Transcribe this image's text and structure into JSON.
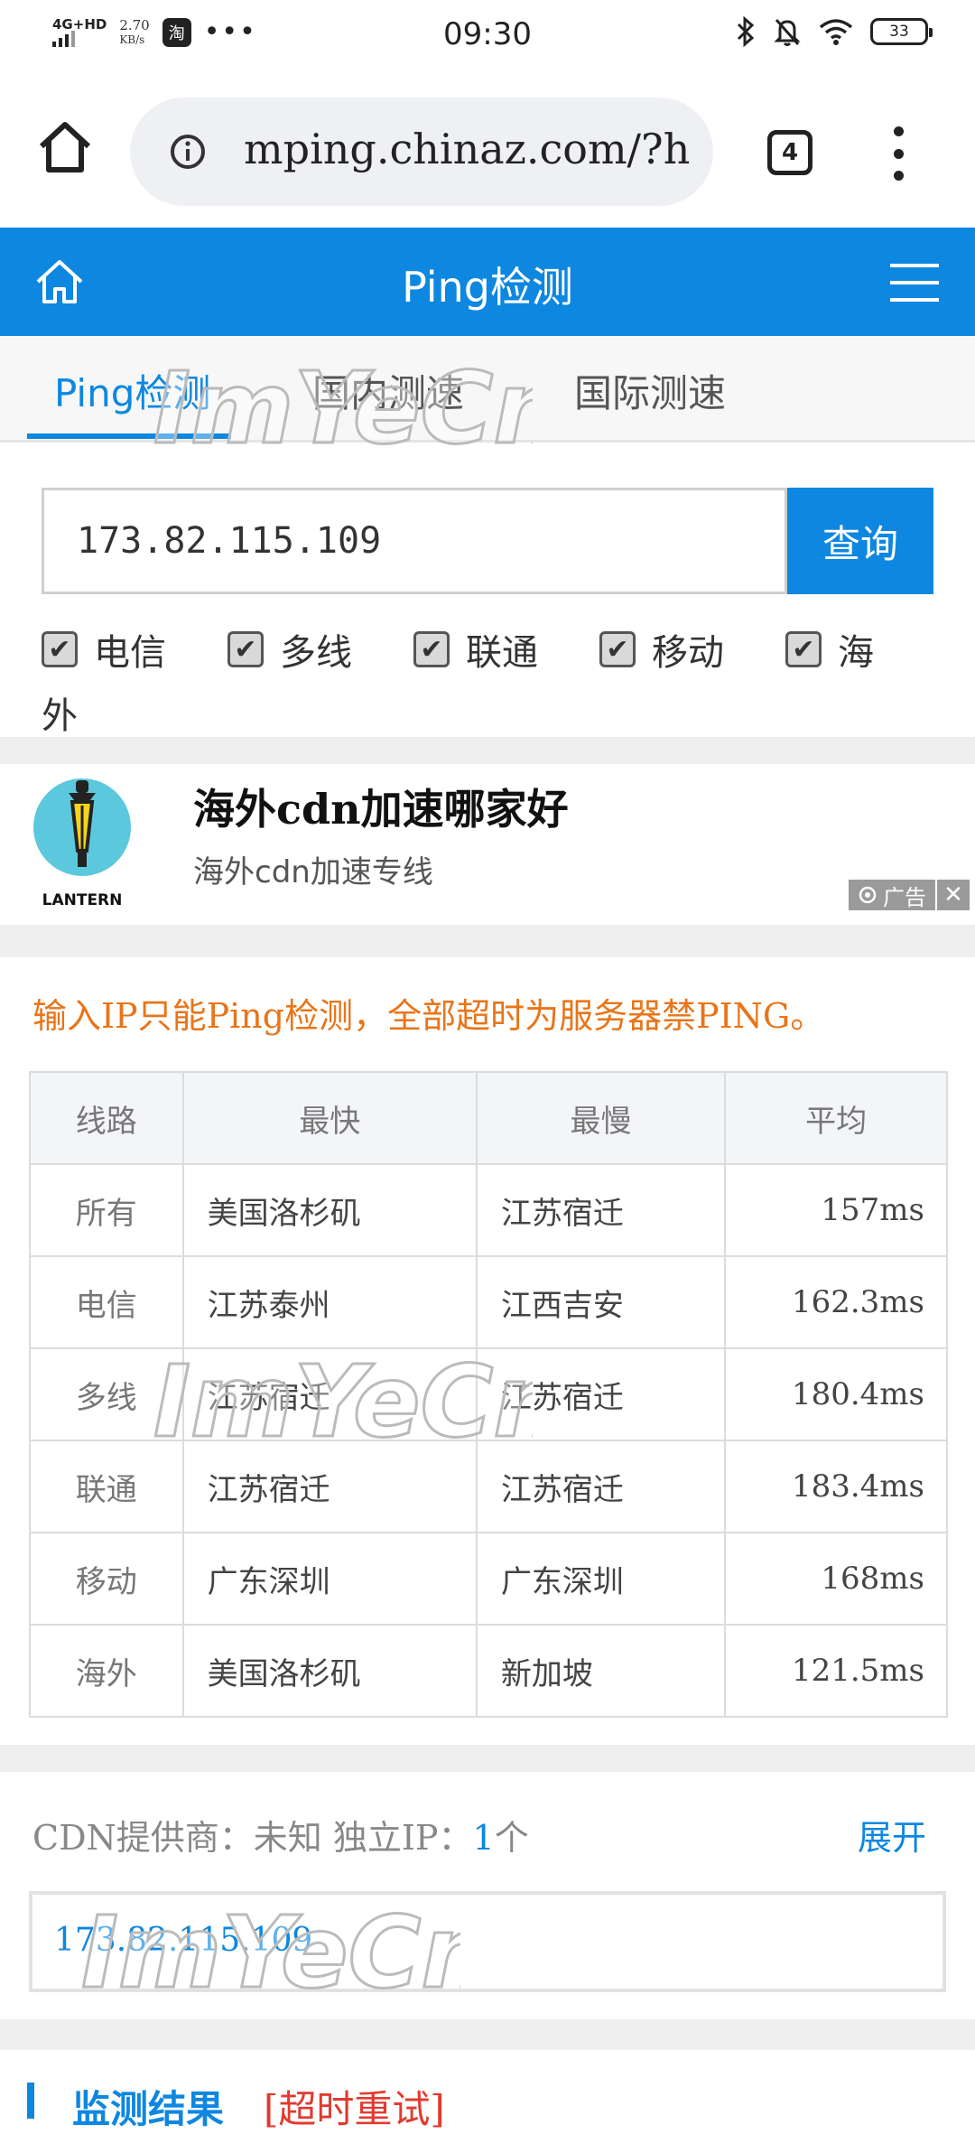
{
  "status_bar": {
    "network": "4G+HD",
    "speed_value": "2.70",
    "speed_unit": "KB/s",
    "app_badge": "淘",
    "more": "•••",
    "time": "09:30",
    "battery": "33"
  },
  "browser": {
    "url": "mping.chinaz.com/?h",
    "tab_count": "4"
  },
  "site": {
    "title": "Ping检测"
  },
  "tabs": [
    {
      "label": "Ping检测",
      "active": true
    },
    {
      "label": "国内测速",
      "active": false
    },
    {
      "label": "国际测速",
      "active": false
    }
  ],
  "search": {
    "value": "173.82.115.109",
    "button": "查询"
  },
  "filters": [
    {
      "label": "电信",
      "checked": true
    },
    {
      "label": "多线",
      "checked": true
    },
    {
      "label": "联通",
      "checked": true
    },
    {
      "label": "移动",
      "checked": true
    },
    {
      "label": "海",
      "checked": true
    }
  ],
  "filters_wrap": "外",
  "ad": {
    "logo_text": "LANTERN",
    "title": "海外cdn加速哪家好",
    "subtitle": "海外cdn加速专线",
    "badge": "广告",
    "close": "✕"
  },
  "notice": "输入IP只能Ping检测，全部超时为服务器禁PING。",
  "table": {
    "headers": [
      "线路",
      "最快",
      "最慢",
      "平均"
    ],
    "rows": [
      [
        "所有",
        "美国洛杉矶",
        "江苏宿迁",
        "157ms"
      ],
      [
        "电信",
        "江苏泰州",
        "江西吉安",
        "162.3ms"
      ],
      [
        "多线",
        "江苏宿迁",
        "江苏宿迁",
        "180.4ms"
      ],
      [
        "联通",
        "江苏宿迁",
        "江苏宿迁",
        "183.4ms"
      ],
      [
        "移动",
        "广东深圳",
        "广东深圳",
        "168ms"
      ],
      [
        "海外",
        "美国洛杉矶",
        "新加坡",
        "121.5ms"
      ]
    ]
  },
  "cdn": {
    "provider_label": "CDN提供商：",
    "provider_value": "未知",
    "ip_label": "独立IP：",
    "ip_count": "1",
    "ip_unit": "个",
    "expand": "展开",
    "ip": "173.82.115.109"
  },
  "monitor": {
    "title": "监测结果",
    "retry": "[超时重试]"
  },
  "watermark": "ImYeCn",
  "colors": {
    "brand_blue": "#0e87e0",
    "notice_orange": "#e8751a",
    "retry_red": "#e23a2f"
  }
}
